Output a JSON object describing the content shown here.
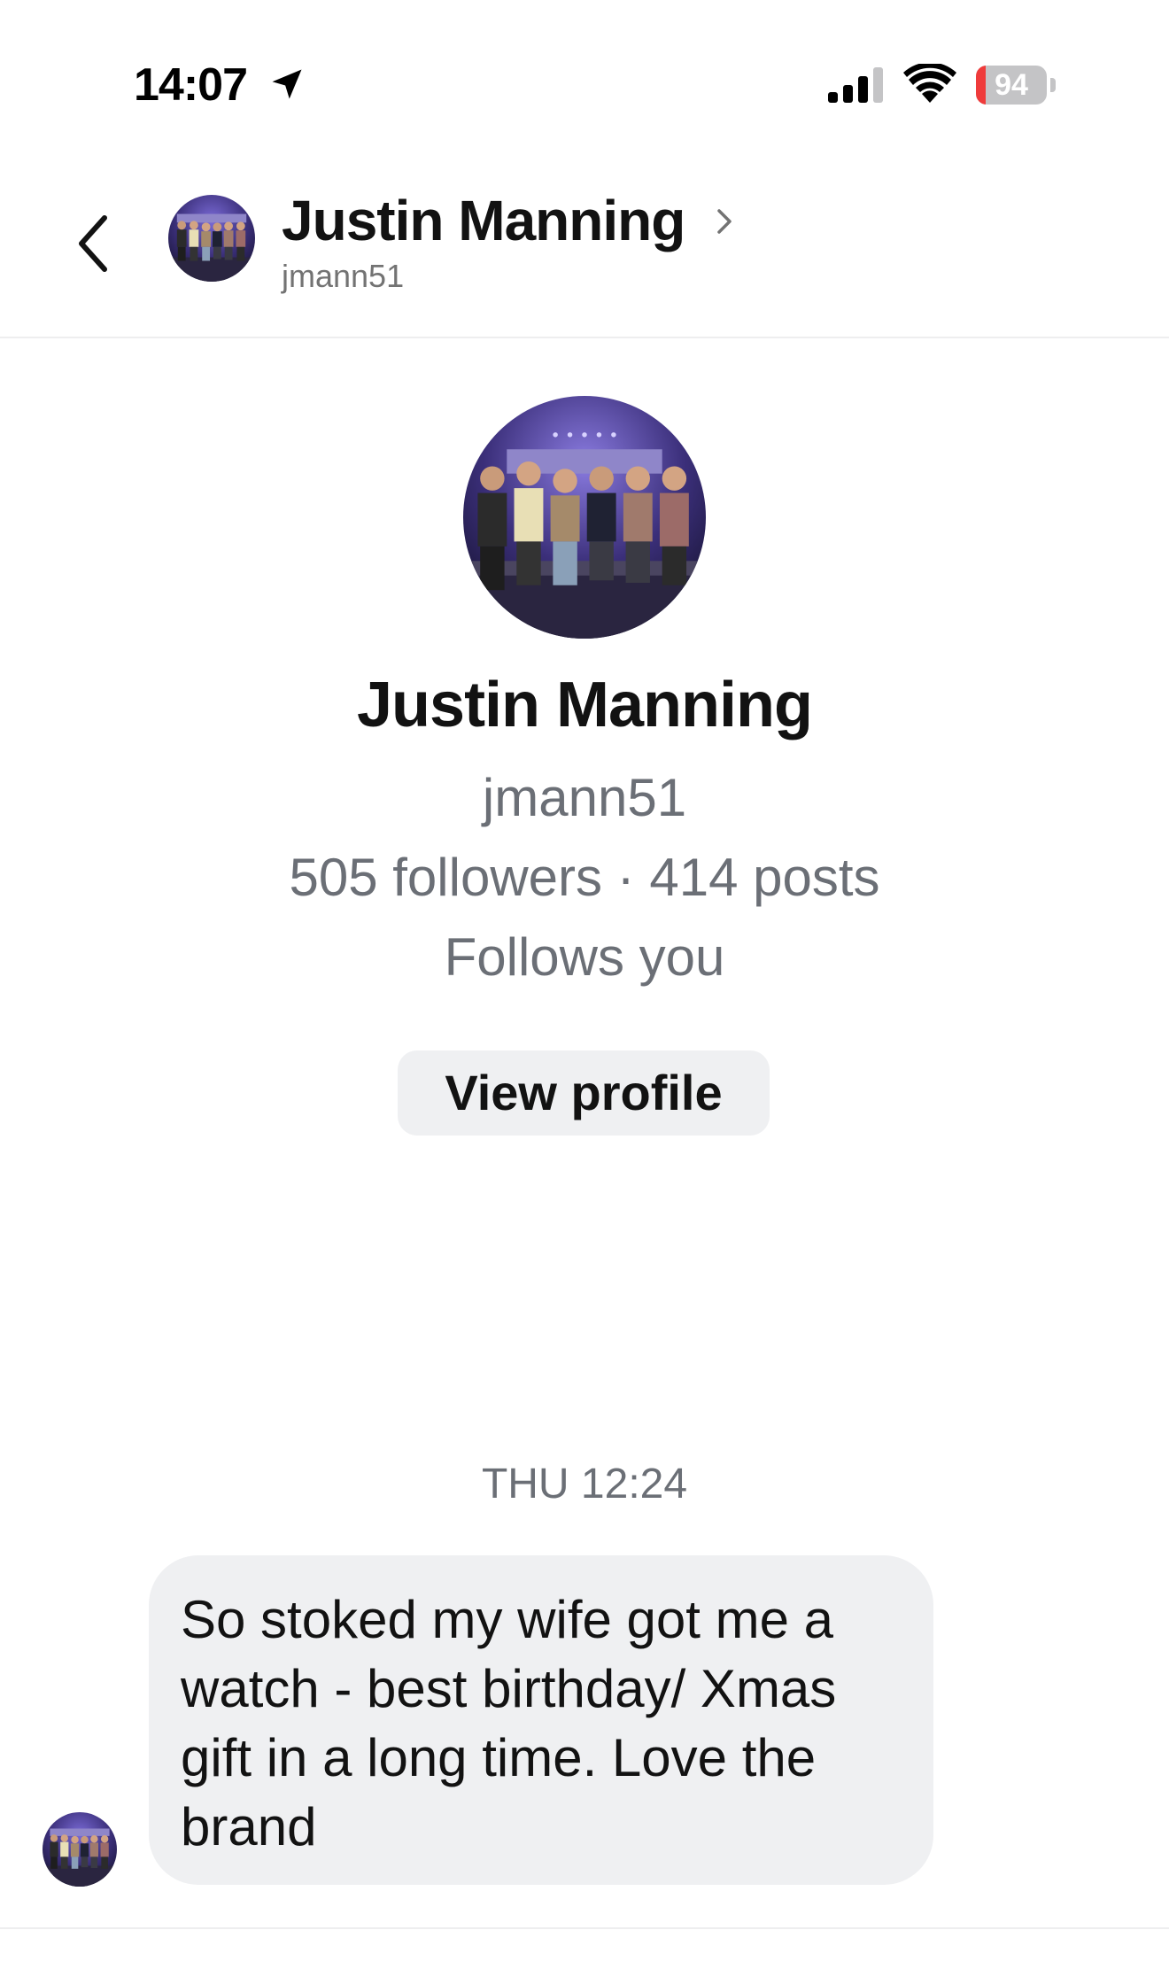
{
  "status_bar": {
    "time": "14:07",
    "battery_level": "94",
    "icons": [
      "location-arrow-icon",
      "cellular-signal-icon",
      "wifi-icon",
      "battery-icon"
    ]
  },
  "header": {
    "name": "Justin Manning",
    "handle": "jmann51",
    "icons": [
      "back-arrow-icon",
      "chevron-right-icon"
    ]
  },
  "profile": {
    "name": "Justin Manning",
    "handle": "jmann51",
    "stats": "505 followers · 414 posts",
    "follows_status": "Follows you",
    "view_profile_label": "View profile"
  },
  "conversation": {
    "timestamp": "THU 12:24",
    "messages": [
      {
        "sender": "incoming",
        "text": "So stoked my wife got me a watch - best birthday/ Xmas gift in a long time. Love the brand"
      }
    ]
  },
  "colors": {
    "text_primary": "#121212",
    "text_secondary": "#6b6f76",
    "bubble_background": "#eff0f2",
    "button_background": "#eff0f2",
    "battery_low": "#ef3b3b"
  }
}
